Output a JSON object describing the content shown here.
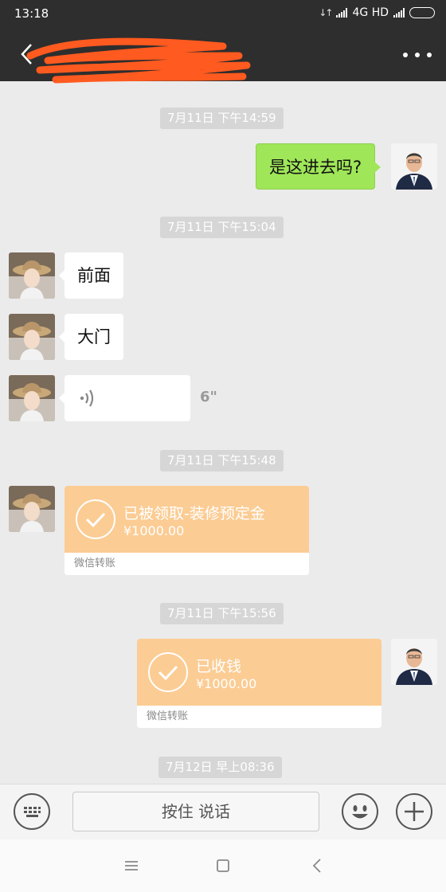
{
  "status_bar": {
    "time": "13:18",
    "network": "4G HD"
  },
  "header": {
    "title": "",
    "back_icon": "chevron-left-icon",
    "more_icon": "more-dots-icon"
  },
  "messages": {
    "ts1": "7月11日 下午14:59",
    "msg1": "是这进去吗?",
    "ts2": "7月11日 下午15:04",
    "msg2": "前面",
    "msg3": "大门",
    "voice_duration": "6\"",
    "ts3": "7月11日 下午15:48",
    "transfer1": {
      "title": "已被领取-装修预定金",
      "amount": "¥1000.00",
      "footer": "微信转账"
    },
    "ts4": "7月11日 下午15:56",
    "transfer2": {
      "title": "已收钱",
      "amount": "¥1000.00",
      "footer": "微信转账"
    },
    "ts5": "7月12日 早上08:36"
  },
  "input_bar": {
    "hold_to_talk": "按住 说话",
    "keyboard_icon": "keyboard-icon",
    "emoji_icon": "emoji-icon",
    "plus_icon": "plus-icon"
  },
  "nav_bar": {
    "menu_icon": "menu-icon",
    "home_icon": "home-icon",
    "back_icon": "back-icon"
  },
  "colors": {
    "header_bg": "#2e2e2e",
    "chat_bg": "#ebebeb",
    "outgoing_bubble": "#9fe658",
    "transfer_orange": "#fbcc94",
    "redaction": "#ff5a1f"
  }
}
